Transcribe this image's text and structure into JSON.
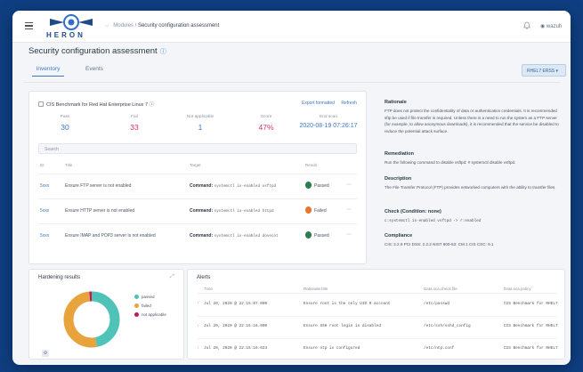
{
  "app": {
    "logo_text": "HERON",
    "breadcrumb": {
      "parent": "Modules",
      "current": "Security configuration assessment"
    },
    "user": "wazuh"
  },
  "page": {
    "title": "Security configuration assessment",
    "info_icon": "info-icon"
  },
  "tabs": [
    {
      "label": "Inventory",
      "active": true
    },
    {
      "label": "Events",
      "active": false
    }
  ],
  "version_select": "RHEL7 ERSS",
  "inventory": {
    "policy": "CIS Benchmark for Red Hat Enterprise Linux 7",
    "actions": {
      "export": "Export formatted",
      "refresh": "Refresh"
    },
    "stats": [
      {
        "label": "Pass",
        "value": "30",
        "color": "#3a78c8"
      },
      {
        "label": "Fail",
        "value": "33",
        "color": "#d6336c"
      },
      {
        "label": "Not applicable",
        "value": "1",
        "color": "#3a78c8"
      },
      {
        "label": "Score",
        "value": "47%",
        "color": "#d6336c"
      },
      {
        "label": "End scan",
        "value": "2020-08-19 07:26:17",
        "color": "#3a78c8"
      }
    ],
    "search_placeholder": "Search",
    "columns": {
      "id": "ID",
      "title": "Title",
      "target": "Target",
      "result": "Result"
    },
    "rows": [
      {
        "id": "5xxx",
        "title": "Ensure FTP server is not enabled",
        "target_label": "Command:",
        "target_value": "systemctl is-enabled vsftpd",
        "result": "Passed",
        "result_color": "#2e7d4f"
      },
      {
        "id": "5xxx",
        "title": "Ensure HTTP server is not enabled",
        "target_label": "Command:",
        "target_value": "systemctl is-enabled httpd",
        "result": "Failed",
        "result_color": "#e8752a"
      },
      {
        "id": "5xxx",
        "title": "Ensure IMAP and POP3 server is not enabled",
        "target_label": "Command:",
        "target_value": "systemctl is-enabled dovecot",
        "result": "Passed",
        "result_color": "#2e7d4f"
      }
    ]
  },
  "rationale": {
    "rationale_title": "Rationale",
    "rationale_text": "FTP does not protect the confidentiality of data or authentication credentials. It is recommended sftp be used if file transfer is required. Unless there is a need to run the system as a FTP server (for example, to allow anonymous downloads), it is recommended that the service be disabled to reduce the potential attack surface.",
    "remediation_title": "Remediation",
    "remediation_text": "Run the following command to disable vsftpd: # systemctl disable vsftpd.",
    "description_title": "Description",
    "description_text": "The File Transfer Protocol (FTP) provides networked computers with the ability to transfer files.",
    "check_title": "Check (Condition: none)",
    "check_text": "c:systemctl is-enabled vsftpd -> r:enabled",
    "compliance_title": "Compliance",
    "compliance_text": "CIS: 2.2.9   PCI DSS: 2.2.2   NIST 800-53: CM.1   CIS CSC: 9.1"
  },
  "hardening": {
    "title": "Hardening results",
    "legend": [
      {
        "label": "passed",
        "color": "#4fc3b8"
      },
      {
        "label": "failed",
        "color": "#e8a33d"
      },
      {
        "label": "not applicable",
        "color": "#c2185b"
      }
    ],
    "counts": {
      "passed": 30,
      "failed": 33,
      "not_applicable": 1
    }
  },
  "alerts": {
    "title": "Alerts",
    "columns": [
      "Time",
      "Rationale.title",
      "Data.sca.check.file",
      "Data.sca.policy"
    ],
    "rows": [
      {
        "time": "Jul 20, 2020 @ 22:15:07.000",
        "title": "Ensure root is the only UID 0 account",
        "file": "/etc/passwd",
        "policy": "CIS Benchmark for RHEL7"
      },
      {
        "time": "Jul 20, 2020 @ 22:15:16.000",
        "title": "Ensure SSH root login is disabled",
        "file": "/etc/ssh/sshd_config",
        "policy": "CIS Benchmark for RHEL7"
      },
      {
        "time": "Jul 20, 2020 @ 22:15:16.024",
        "title": "Ensure ntp is configured",
        "file": "/etc/ntp.conf",
        "policy": "CIS Benchmark for RHEL7"
      }
    ]
  }
}
